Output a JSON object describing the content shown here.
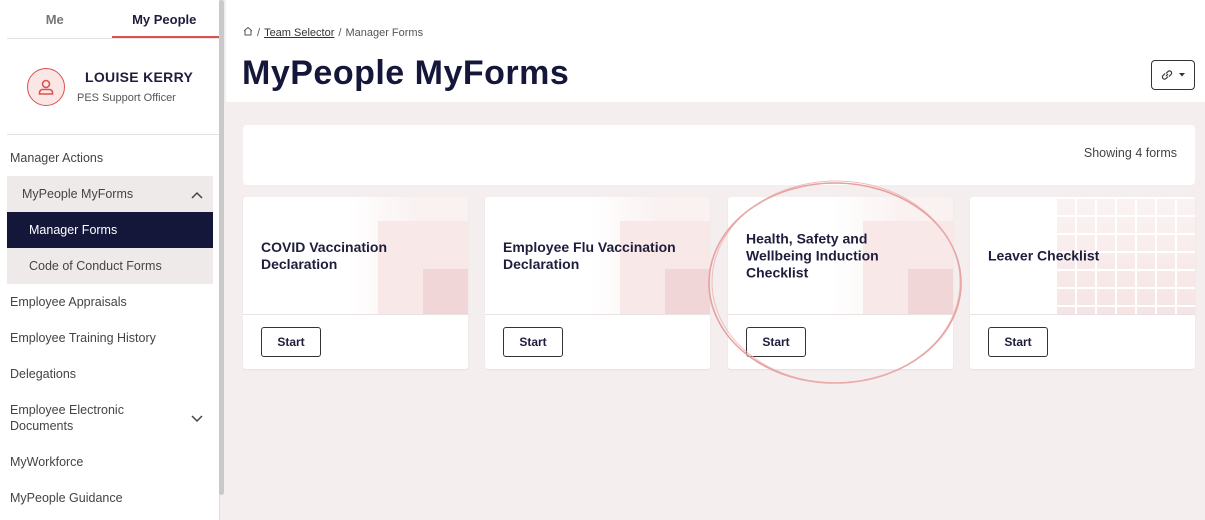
{
  "sidebar": {
    "tabs": [
      {
        "label": "Me"
      },
      {
        "label": "My People"
      }
    ],
    "profile": {
      "name": "LOUISE KERRY",
      "role": "PES Support Officer"
    },
    "nav": {
      "manager_actions": "Manager Actions",
      "mypeople_myforms": "MyPeople MyForms",
      "manager_forms": "Manager Forms",
      "code_of_conduct": "Code of Conduct Forms",
      "appraisals": "Employee Appraisals",
      "training_history": "Employee Training History",
      "delegations": "Delegations",
      "electronic_docs": "Employee Electronic Documents",
      "myworkforce": "MyWorkforce",
      "guidance": "MyPeople Guidance"
    }
  },
  "header": {
    "breadcrumb": {
      "sep1": "/",
      "team_selector": "Team Selector",
      "sep2": "/",
      "current": "Manager Forms"
    },
    "title": "MyPeople MyForms"
  },
  "forms": {
    "count_text": "Showing 4 forms",
    "cards": [
      {
        "title": "COVID Vaccination Declaration",
        "button": "Start"
      },
      {
        "title": "Employee Flu Vaccination Declaration",
        "button": "Start"
      },
      {
        "title": "Health, Safety and Wellbeing Induction Checklist",
        "button": "Start"
      },
      {
        "title": "Leaver Checklist",
        "button": "Start"
      }
    ]
  },
  "colors": {
    "accent": "#d9534f",
    "navy": "#14163a",
    "background": "#f4eeee"
  }
}
